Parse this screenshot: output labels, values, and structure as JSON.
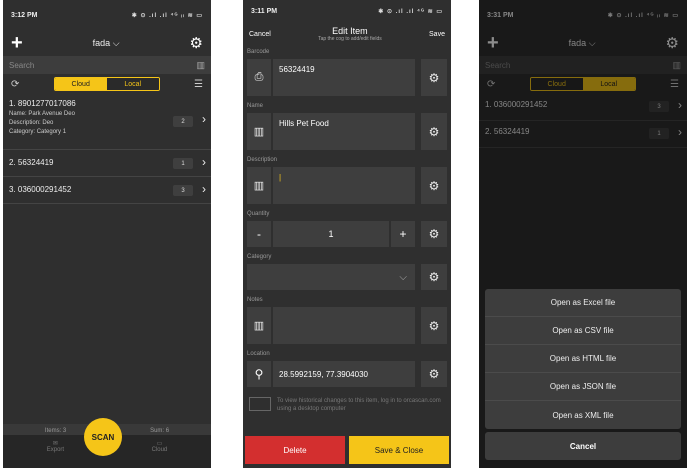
{
  "phone1": {
    "status": {
      "time": "3:12 PM",
      "icons": "✱ ⊙ .ıl .ıl ⁴ᴳ ᵢₗ ≋ ▭"
    },
    "title": "fada",
    "search_placeholder": "Search",
    "seg_cloud": "Cloud",
    "seg_local": "Local",
    "items": [
      {
        "label": "1. 8901277017086",
        "name_label": "Name:",
        "name": "Park Avenue Deo",
        "desc_label": "Description:",
        "desc": "Deo",
        "cat_label": "Category:",
        "cat": "Category 1",
        "count": "2"
      },
      {
        "label": "2. 56324419",
        "count": "1"
      },
      {
        "label": "3. 036000291452",
        "count": "3"
      }
    ],
    "footer": {
      "items": "Items: 3",
      "sum": "Sum: 6",
      "scan": "SCAN",
      "nav_left": "Export",
      "nav_right": "Cloud"
    }
  },
  "phone2": {
    "status": {
      "time": "3:11 PM",
      "icons": "✱ ⊙ .ıl .ıl ⁴ᴳ ≋ ▭"
    },
    "cancel": "Cancel",
    "title": "Edit Item",
    "subtitle": "Tap the cog to add/edit fields",
    "save": "Save",
    "fields": {
      "barcode_label": "Barcode",
      "barcode": "56324419",
      "name_label": "Name",
      "name": "Hills Pet Food",
      "desc_label": "Description",
      "desc": "",
      "qty_label": "Quantity",
      "qty": "1",
      "cat_label": "Category",
      "notes_label": "Notes",
      "loc_label": "Location",
      "loc": "28.5992159, 77.3904030"
    },
    "hint": "To view historical changes to this item, log in to orcascan.com using a desktop computer",
    "delete": "Delete",
    "save_close": "Save & Close"
  },
  "phone3": {
    "status": {
      "time": "3:31 PM",
      "icons": "✱ ⊙ .ıl .ıl ⁴ᴳ ᵢₗ ≋ ▭"
    },
    "title": "fada",
    "search_placeholder": "Search",
    "seg_cloud": "Cloud",
    "seg_local": "Local",
    "items": [
      {
        "label": "1. 036000291452",
        "count": "3"
      },
      {
        "label": "2. 56324419",
        "count": "1"
      }
    ],
    "options": [
      "Open as Excel file",
      "Open as CSV file",
      "Open as HTML file",
      "Open as JSON file",
      "Open as XML file"
    ],
    "cancel": "Cancel"
  },
  "colors": {
    "accent": "#f5c518",
    "danger": "#d32f2f",
    "bg": "#2f2f2f"
  }
}
